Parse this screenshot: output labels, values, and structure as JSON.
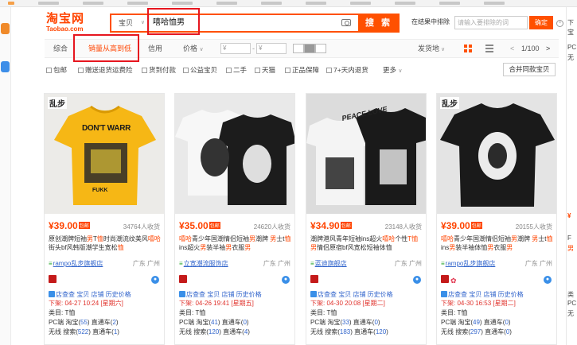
{
  "search": {
    "logo_cn": "淘宝网",
    "logo_en": "Taobao.com",
    "category": "宝贝",
    "query": "嘻哈恤男",
    "button": "搜 索",
    "exclude_label": "在结果中排除",
    "exclude_placeholder": "请输入要排除的词",
    "confirm": "确定"
  },
  "sort": {
    "comprehensive": "综合",
    "sales_desc": "销量从高到低",
    "credit": "信用",
    "price": "价格",
    "price_min": "¥",
    "price_max": "¥",
    "ship_from": "发货地",
    "page_indicator": "1/100"
  },
  "filters": {
    "items": [
      "包邮",
      "赠送退货运费险",
      "货到付款",
      "公益宝贝",
      "二手",
      "天猫",
      "正品保障",
      "7+天内退货",
      "更多"
    ],
    "merge_button": "合并同款宝贝"
  },
  "products": [
    {
      "price": "¥39.00",
      "price_tag": "包邮",
      "sales": "34764人收货",
      "title_parts": [
        "原创潮牌短袖",
        "男",
        "T",
        "恤",
        "时尚潮流纹美风",
        "嘻哈",
        "街头bf风韩版潮学生宽松",
        "恤"
      ],
      "shop": "rampo乱步旗舰店",
      "location": "广东 广州",
      "tools": "店查查 宝贝 店铺 历史价格",
      "listed": "下架: 04-27 10:24 [星期六]",
      "category": "类目: T恤",
      "pc": [
        "PC端 淘宝(",
        "55",
        ") 直通车(",
        "2",
        ")"
      ],
      "wireless": [
        "无线 搜索(",
        "522",
        ") 直通车(",
        "1",
        ")"
      ]
    },
    {
      "price": "¥35.00",
      "price_tag": "包邮",
      "sales": "24620人收货",
      "title_parts": [
        "嘻哈",
        "青少年国潮情侣短袖",
        "男",
        "潮牌 ",
        "男",
        "士t",
        "恤",
        "ins超火",
        "男",
        "装半袖",
        "男",
        "衣服",
        "男",
        ""
      ],
      "shop": "立宽潮流服饰店",
      "location": "广东 广州",
      "tools": "店查查 宝贝 店铺 历史价格",
      "listed": "下架: 04-26 19:41 [星期五]",
      "category": "类目: T恤",
      "pc": [
        "PC端 淘宝(",
        "41",
        ") 直通车(",
        "0",
        ")"
      ],
      "wireless": [
        "无线 搜索(",
        "120",
        ") 直通车(",
        "4",
        ")"
      ]
    },
    {
      "price": "¥34.90",
      "price_tag": "包邮",
      "sales": "23148人收货",
      "title_parts": [
        "潮牌港风青年短袖ins超火",
        "嘻哈",
        "个性",
        "T恤",
        "",
        "男",
        "",
        "情侣原宿bf风宽松短袖体恤",
        ""
      ],
      "shop": "蓝迪旗舰店",
      "location": "广东 广州",
      "tools": "店查查 宝贝 店铺 历史价格",
      "listed": "下架: 04-30 20:08 [星期二]",
      "category": "类目: T恤",
      "pc": [
        "PC端 淘宝(",
        "33",
        ") 直通车(",
        "0",
        ")"
      ],
      "wireless": [
        "无线 搜索(",
        "183",
        ") 直通车(",
        "120",
        ")"
      ]
    },
    {
      "price": "¥39.00",
      "price_tag": "包邮",
      "sales": "20155人收货",
      "title_parts": [
        "嘻哈",
        "青少年国潮情侣短袖",
        "男",
        "潮牌 ",
        "男",
        "士t",
        "恤",
        "ins",
        "男",
        "装半袖体恤",
        "男",
        "衣服",
        "男",
        ""
      ],
      "shop": "rampo乱步旗舰店",
      "location": "广东 广州",
      "tools": "店查查 宝贝 店铺 历史价格",
      "listed": "下架: 04-30 16:53 [星期二]",
      "category": "类目: T恤",
      "pc": [
        "PC端 淘宝(",
        "49",
        ") 直通车(",
        "0",
        ")"
      ],
      "wireless": [
        "无线 搜索(",
        "297",
        ") 直通车(",
        "0",
        ")"
      ]
    }
  ],
  "image_text": {
    "brand": "乱步",
    "shirt1_text": "DON'T WARR",
    "shirt1_sub": "FUKK",
    "shirt3_text": "PEACE LOVE"
  },
  "sidebar_right": [
    "下",
    "宝",
    "PC",
    "无",
    "¥",
    "F",
    "男",
    "类",
    "PC",
    "无"
  ],
  "colors": {
    "accent": "#ff5000",
    "price": "#ff4400",
    "link": "#3366cc",
    "annotation": "#e6161f"
  }
}
